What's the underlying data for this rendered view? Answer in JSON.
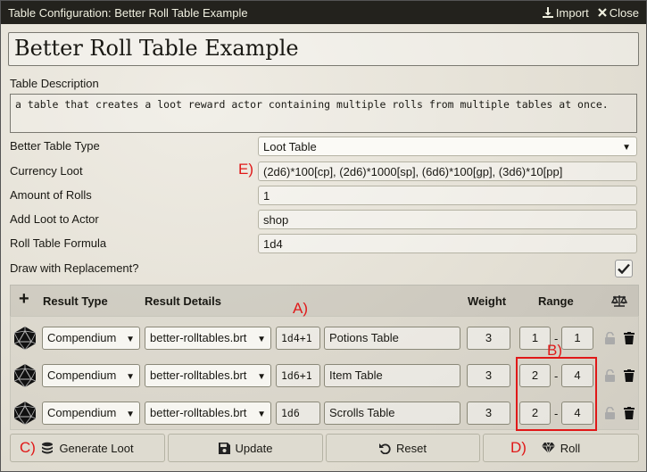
{
  "window": {
    "title": "Table Configuration: Better Roll Table Example",
    "import_label": "Import",
    "close_label": "Close"
  },
  "table_name": "Better Roll Table Example",
  "description": {
    "label": "Table Description",
    "text": "a table that creates a loot reward actor containing multiple rolls from multiple tables at once."
  },
  "settings": {
    "type_label": "Better Table Type",
    "type_value": "Loot Table",
    "currency_label": "Currency Loot",
    "currency_value": "(2d6)*100[cp], (2d6)*1000[sp], (6d6)*100[gp], (3d6)*10[pp]",
    "rolls_label": "Amount of Rolls",
    "rolls_value": "1",
    "actor_label": "Add Loot to Actor",
    "actor_value": "shop",
    "formula_label": "Roll Table Formula",
    "formula_value": "1d4",
    "replacement_label": "Draw with Replacement?",
    "replacement_checked": true
  },
  "results_header": {
    "type": "Result Type",
    "details": "Result Details",
    "weight": "Weight",
    "range": "Range"
  },
  "results": [
    {
      "type": "Compendium",
      "collection": "better-rolltables.brt",
      "formula": "1d4+1",
      "name": "Potions Table",
      "weight": "3",
      "range_low": "1",
      "range_high": "1"
    },
    {
      "type": "Compendium",
      "collection": "better-rolltables.brt",
      "formula": "1d6+1",
      "name": "Item Table",
      "weight": "3",
      "range_low": "2",
      "range_high": "4"
    },
    {
      "type": "Compendium",
      "collection": "better-rolltables.brt",
      "formula": "1d6",
      "name": "Scrolls Table",
      "weight": "3",
      "range_low": "2",
      "range_high": "4"
    }
  ],
  "range_separator": "-",
  "annotations": {
    "a": "A)",
    "b": "B)",
    "c": "C)",
    "d": "D)",
    "e": "E)"
  },
  "footer": {
    "generate_label": "Generate Loot",
    "update_label": "Update",
    "reset_label": "Reset",
    "roll_label": "Roll"
  },
  "colors": {
    "titlebar": "#23221d",
    "annotation": "#e01818",
    "parchment": "#e7e3d8"
  },
  "icons": [
    "download-icon",
    "close-icon",
    "plus-icon",
    "balance-scale-icon",
    "d20-icon",
    "lock-icon",
    "trash-icon",
    "coins-icon",
    "save-icon",
    "undo-icon",
    "gem-icon",
    "checkmark-icon"
  ]
}
